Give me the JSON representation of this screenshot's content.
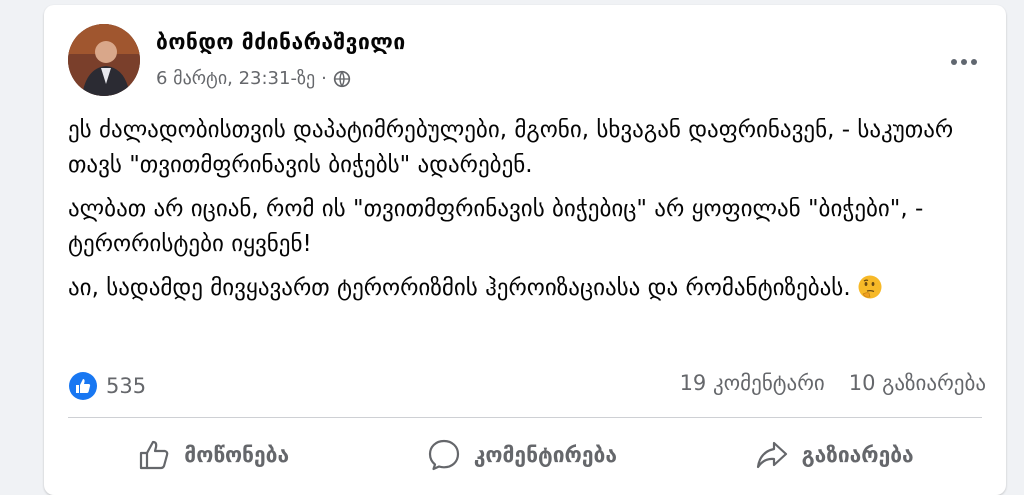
{
  "post": {
    "author": "ბონდო მძინარაშვილი",
    "date": "6 მარტი, 23:31-ზე",
    "separator": "·",
    "privacy_icon": "globe-icon",
    "more_icon": "more-options-icon",
    "paragraphs": [
      "ეს ძალადობისთვის დაპატიმრებულები, მგონი, სხვაგან დაფრინავენ, - საკუთარ თავს \"თვითმფრინავის ბიჭებს\" ადარებენ.",
      "ალბათ არ იციან, რომ ის \"თვითმფრინავის ბიჭებიც\" არ ყოფილან \"ბიჭები\", - ტერორისტები იყვნენ!",
      "აი, სადამდე მივყავართ ტერორიზმის ჰეროიზაციასა და რომანტიზებას."
    ],
    "emoji": "thinking-face-emoji"
  },
  "stats": {
    "likes": "535",
    "comments": "19 კომენტარი",
    "shares": "10 გაზიარება",
    "like_color": "#1877f2"
  },
  "actions": {
    "like": "მოწონება",
    "comment": "კომენტირება",
    "share": "გაზიარება"
  }
}
